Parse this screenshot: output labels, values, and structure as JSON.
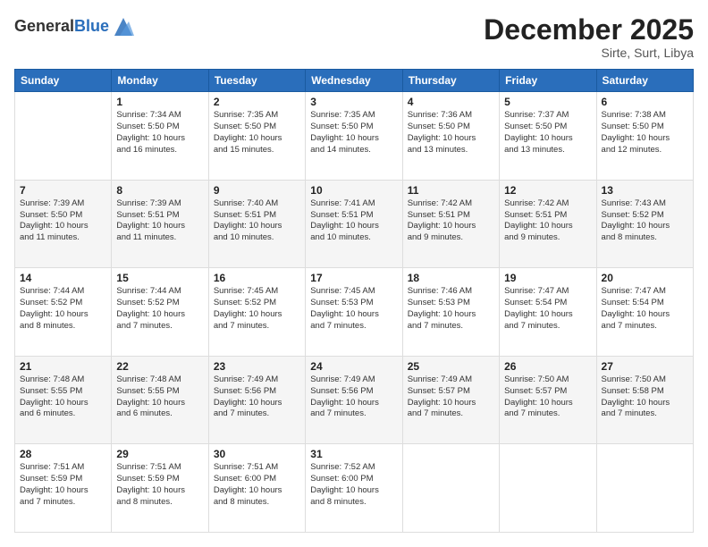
{
  "header": {
    "logo_line1": "General",
    "logo_line2": "Blue",
    "month_title": "December 2025",
    "location": "Sirte, Surt, Libya"
  },
  "columns": [
    "Sunday",
    "Monday",
    "Tuesday",
    "Wednesday",
    "Thursday",
    "Friday",
    "Saturday"
  ],
  "weeks": [
    [
      {
        "day": "",
        "info": ""
      },
      {
        "day": "1",
        "info": "Sunrise: 7:34 AM\nSunset: 5:50 PM\nDaylight: 10 hours\nand 16 minutes."
      },
      {
        "day": "2",
        "info": "Sunrise: 7:35 AM\nSunset: 5:50 PM\nDaylight: 10 hours\nand 15 minutes."
      },
      {
        "day": "3",
        "info": "Sunrise: 7:35 AM\nSunset: 5:50 PM\nDaylight: 10 hours\nand 14 minutes."
      },
      {
        "day": "4",
        "info": "Sunrise: 7:36 AM\nSunset: 5:50 PM\nDaylight: 10 hours\nand 13 minutes."
      },
      {
        "day": "5",
        "info": "Sunrise: 7:37 AM\nSunset: 5:50 PM\nDaylight: 10 hours\nand 13 minutes."
      },
      {
        "day": "6",
        "info": "Sunrise: 7:38 AM\nSunset: 5:50 PM\nDaylight: 10 hours\nand 12 minutes."
      }
    ],
    [
      {
        "day": "7",
        "info": "Sunrise: 7:39 AM\nSunset: 5:50 PM\nDaylight: 10 hours\nand 11 minutes."
      },
      {
        "day": "8",
        "info": "Sunrise: 7:39 AM\nSunset: 5:51 PM\nDaylight: 10 hours\nand 11 minutes."
      },
      {
        "day": "9",
        "info": "Sunrise: 7:40 AM\nSunset: 5:51 PM\nDaylight: 10 hours\nand 10 minutes."
      },
      {
        "day": "10",
        "info": "Sunrise: 7:41 AM\nSunset: 5:51 PM\nDaylight: 10 hours\nand 10 minutes."
      },
      {
        "day": "11",
        "info": "Sunrise: 7:42 AM\nSunset: 5:51 PM\nDaylight: 10 hours\nand 9 minutes."
      },
      {
        "day": "12",
        "info": "Sunrise: 7:42 AM\nSunset: 5:51 PM\nDaylight: 10 hours\nand 9 minutes."
      },
      {
        "day": "13",
        "info": "Sunrise: 7:43 AM\nSunset: 5:52 PM\nDaylight: 10 hours\nand 8 minutes."
      }
    ],
    [
      {
        "day": "14",
        "info": "Sunrise: 7:44 AM\nSunset: 5:52 PM\nDaylight: 10 hours\nand 8 minutes."
      },
      {
        "day": "15",
        "info": "Sunrise: 7:44 AM\nSunset: 5:52 PM\nDaylight: 10 hours\nand 7 minutes."
      },
      {
        "day": "16",
        "info": "Sunrise: 7:45 AM\nSunset: 5:52 PM\nDaylight: 10 hours\nand 7 minutes."
      },
      {
        "day": "17",
        "info": "Sunrise: 7:45 AM\nSunset: 5:53 PM\nDaylight: 10 hours\nand 7 minutes."
      },
      {
        "day": "18",
        "info": "Sunrise: 7:46 AM\nSunset: 5:53 PM\nDaylight: 10 hours\nand 7 minutes."
      },
      {
        "day": "19",
        "info": "Sunrise: 7:47 AM\nSunset: 5:54 PM\nDaylight: 10 hours\nand 7 minutes."
      },
      {
        "day": "20",
        "info": "Sunrise: 7:47 AM\nSunset: 5:54 PM\nDaylight: 10 hours\nand 7 minutes."
      }
    ],
    [
      {
        "day": "21",
        "info": "Sunrise: 7:48 AM\nSunset: 5:55 PM\nDaylight: 10 hours\nand 6 minutes."
      },
      {
        "day": "22",
        "info": "Sunrise: 7:48 AM\nSunset: 5:55 PM\nDaylight: 10 hours\nand 6 minutes."
      },
      {
        "day": "23",
        "info": "Sunrise: 7:49 AM\nSunset: 5:56 PM\nDaylight: 10 hours\nand 7 minutes."
      },
      {
        "day": "24",
        "info": "Sunrise: 7:49 AM\nSunset: 5:56 PM\nDaylight: 10 hours\nand 7 minutes."
      },
      {
        "day": "25",
        "info": "Sunrise: 7:49 AM\nSunset: 5:57 PM\nDaylight: 10 hours\nand 7 minutes."
      },
      {
        "day": "26",
        "info": "Sunrise: 7:50 AM\nSunset: 5:57 PM\nDaylight: 10 hours\nand 7 minutes."
      },
      {
        "day": "27",
        "info": "Sunrise: 7:50 AM\nSunset: 5:58 PM\nDaylight: 10 hours\nand 7 minutes."
      }
    ],
    [
      {
        "day": "28",
        "info": "Sunrise: 7:51 AM\nSunset: 5:59 PM\nDaylight: 10 hours\nand 7 minutes."
      },
      {
        "day": "29",
        "info": "Sunrise: 7:51 AM\nSunset: 5:59 PM\nDaylight: 10 hours\nand 8 minutes."
      },
      {
        "day": "30",
        "info": "Sunrise: 7:51 AM\nSunset: 6:00 PM\nDaylight: 10 hours\nand 8 minutes."
      },
      {
        "day": "31",
        "info": "Sunrise: 7:52 AM\nSunset: 6:00 PM\nDaylight: 10 hours\nand 8 minutes."
      },
      {
        "day": "",
        "info": ""
      },
      {
        "day": "",
        "info": ""
      },
      {
        "day": "",
        "info": ""
      }
    ]
  ]
}
